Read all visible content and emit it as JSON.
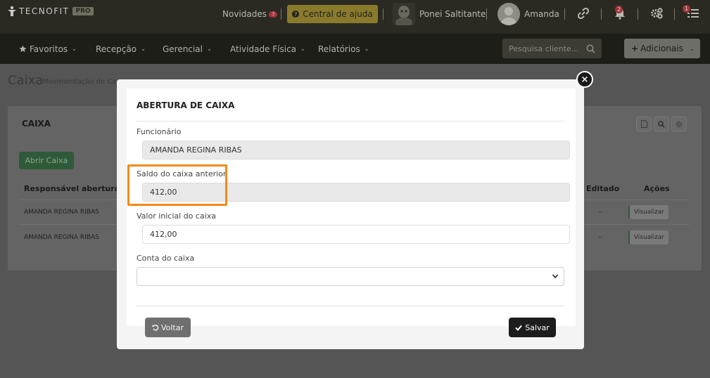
{
  "topbar": {
    "logo_text": "TECNOFIT",
    "logo_badge": "PRO",
    "news_label": "Novidades",
    "news_count": "3",
    "help_label": "Central de ajuda",
    "help_icon": "?",
    "gym_name": "Ponei Saltitante",
    "user_name": "Amanda",
    "bell_count": "2",
    "menu_count": "1"
  },
  "nav": {
    "items": [
      {
        "label": "Favoritos"
      },
      {
        "label": "Recepção"
      },
      {
        "label": "Gerencial"
      },
      {
        "label": "Atividade Física"
      },
      {
        "label": "Relatórios"
      }
    ],
    "search_placeholder": "Pesquisa cliente...",
    "add_label": "Adicionais"
  },
  "page": {
    "title": "Caixa",
    "subtitle": "Movimentação de Ca"
  },
  "panel": {
    "title": "CAIXA",
    "open_button": "Abrir Caixa",
    "columns": {
      "responsavel": "Responsável abertura",
      "editado": "Editado",
      "acoes": "Ações"
    },
    "rows": [
      {
        "responsavel": "AMANDA REGINA RIBAS",
        "editado": "--",
        "action": "Visualizar"
      },
      {
        "responsavel": "AMANDA REGINA RIBAS",
        "editado": "--",
        "action": "Visualizar"
      }
    ]
  },
  "modal": {
    "title": "ABERTURA DE CAIXA",
    "close_glyph": "×",
    "fields": {
      "funcionario_label": "Funcionário",
      "funcionario_value": "AMANDA REGINA RIBAS",
      "saldo_label": "Saldo do caixa anterior",
      "saldo_value": "412,00",
      "valor_label": "Valor inicial do caixa",
      "valor_value": "412,00",
      "conta_label": "Conta do caixa",
      "conta_value": ""
    },
    "back_button": "Voltar",
    "save_button": "Salvar"
  },
  "colors": {
    "highlight": "#f08a1c",
    "primary_green": "#2e5a39",
    "save_dark": "#1d1d1d"
  }
}
